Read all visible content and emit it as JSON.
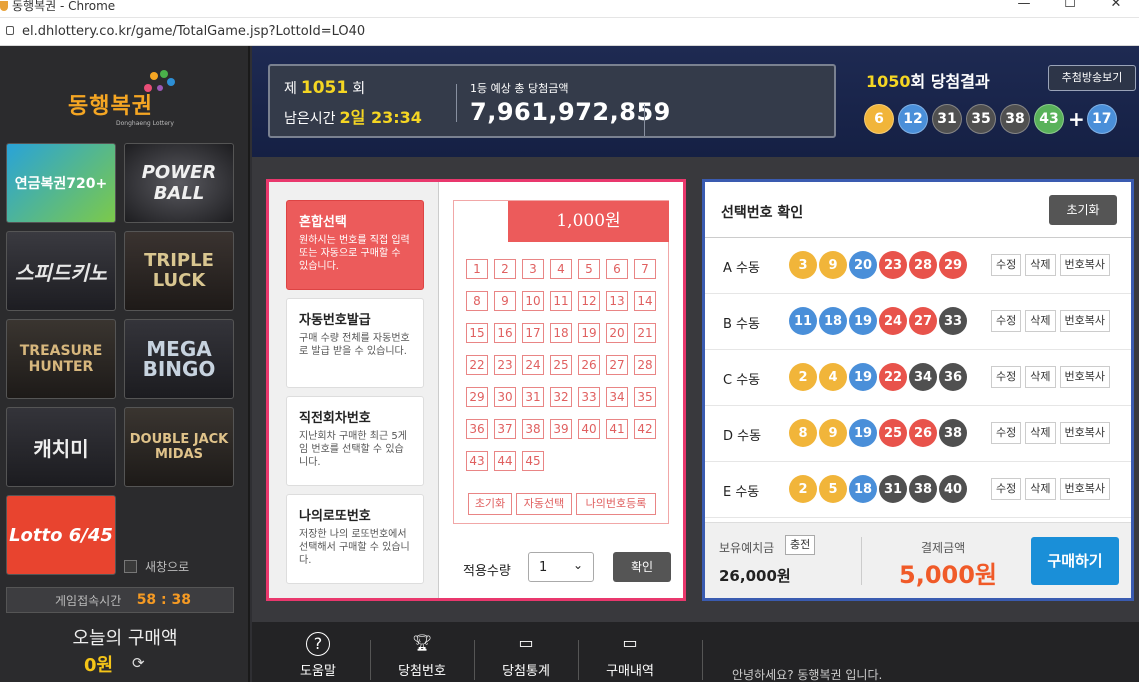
{
  "browser": {
    "title": "동행복권 - Chrome",
    "url": "el.dhlottery.co.kr/game/TotalGame.jsp?LottoId=LO40"
  },
  "sidebar": {
    "logo_text": "동행복권",
    "logo_sub": "Donghaeng Lottery",
    "games": [
      {
        "name": "연금복권720+"
      },
      {
        "name": "POWER BALL"
      },
      {
        "name": "스피드키노"
      },
      {
        "name": "TRIPLE LUCK"
      },
      {
        "name": "TREASURE HUNTER"
      },
      {
        "name": "MEGA BINGO"
      },
      {
        "name": "캐치미"
      },
      {
        "name": "DOUBLE JACK MIDAS"
      },
      {
        "name": "Lotto 6/45"
      }
    ],
    "new_window_label": "새창으로",
    "connect_label": "게임접속시간",
    "connect_time": "58 : 38",
    "today_label": "오늘의 구매액",
    "today_value": "0원"
  },
  "topbar": {
    "round_prefix": "제",
    "round_no": "1051",
    "round_suffix": "회",
    "remain_label": "남은시간",
    "remain_value": "2일 23:34",
    "prize_label": "1등 예상 총 당첨금액",
    "prize_value": "7,961,972,859",
    "result_round": "1050",
    "result_suffix": "회 당첨결과",
    "watch_button": "추첨방송보기",
    "win_numbers": [
      {
        "n": "6",
        "c": "y"
      },
      {
        "n": "12",
        "c": "b"
      },
      {
        "n": "31",
        "c": "g"
      },
      {
        "n": "35",
        "c": "g"
      },
      {
        "n": "38",
        "c": "g"
      },
      {
        "n": "43",
        "c": "gr"
      }
    ],
    "bonus": {
      "n": "17",
      "c": "b"
    }
  },
  "methods": [
    {
      "title": "혼합선택",
      "desc": "원하시는 번호를 직접 입력 또는 자동으로 구매할 수 있습니다.",
      "active": true
    },
    {
      "title": "자동번호발급",
      "desc": "구매 수량 전체를 자동번호로 발급 받을 수 있습니다.",
      "active": false
    },
    {
      "title": "직전회차번호",
      "desc": "지난회차 구매한 최근 5게임 번호를 선택할 수 있습니다.",
      "active": false
    },
    {
      "title": "나의로또번호",
      "desc": "저장한 나의 로또번호에서 선택해서 구매할 수 있습니다.",
      "active": false
    }
  ],
  "slip": {
    "price": "1,000원",
    "numbers": [
      "1",
      "2",
      "3",
      "4",
      "5",
      "6",
      "7",
      "8",
      "9",
      "10",
      "11",
      "12",
      "13",
      "14",
      "15",
      "16",
      "17",
      "18",
      "19",
      "20",
      "21",
      "22",
      "23",
      "24",
      "25",
      "26",
      "27",
      "28",
      "29",
      "30",
      "31",
      "32",
      "33",
      "34",
      "35",
      "36",
      "37",
      "38",
      "39",
      "40",
      "41",
      "42",
      "43",
      "44",
      "45"
    ],
    "reset": "초기화",
    "auto": "자동선택",
    "mynum": "나의번호등록"
  },
  "quantity": {
    "label": "적용수량",
    "value": "1",
    "confirm": "확인"
  },
  "selected": {
    "title": "선택번호 확인",
    "reset": "초기화",
    "rows": [
      {
        "label": "A 수동",
        "balls": [
          {
            "n": "3",
            "c": "y"
          },
          {
            "n": "9",
            "c": "y"
          },
          {
            "n": "20",
            "c": "b"
          },
          {
            "n": "23",
            "c": "r"
          },
          {
            "n": "28",
            "c": "r"
          },
          {
            "n": "29",
            "c": "r"
          }
        ]
      },
      {
        "label": "B 수동",
        "balls": [
          {
            "n": "11",
            "c": "b"
          },
          {
            "n": "18",
            "c": "b"
          },
          {
            "n": "19",
            "c": "b"
          },
          {
            "n": "24",
            "c": "r"
          },
          {
            "n": "27",
            "c": "r"
          },
          {
            "n": "33",
            "c": "g"
          }
        ]
      },
      {
        "label": "C 수동",
        "balls": [
          {
            "n": "2",
            "c": "y"
          },
          {
            "n": "4",
            "c": "y"
          },
          {
            "n": "19",
            "c": "b"
          },
          {
            "n": "22",
            "c": "r"
          },
          {
            "n": "34",
            "c": "g"
          },
          {
            "n": "36",
            "c": "g"
          }
        ]
      },
      {
        "label": "D 수동",
        "balls": [
          {
            "n": "8",
            "c": "y"
          },
          {
            "n": "9",
            "c": "y"
          },
          {
            "n": "19",
            "c": "b"
          },
          {
            "n": "25",
            "c": "r"
          },
          {
            "n": "26",
            "c": "r"
          },
          {
            "n": "38",
            "c": "g"
          }
        ]
      },
      {
        "label": "E 수동",
        "balls": [
          {
            "n": "2",
            "c": "y"
          },
          {
            "n": "5",
            "c": "y"
          },
          {
            "n": "18",
            "c": "b"
          },
          {
            "n": "31",
            "c": "g"
          },
          {
            "n": "38",
            "c": "g"
          },
          {
            "n": "40",
            "c": "g"
          }
        ]
      }
    ],
    "actions": [
      "수정",
      "삭제",
      "번호복사"
    ],
    "balance_label": "보유예치금",
    "charge": "충전",
    "balance": "26,000원",
    "pay_label": "결제금액",
    "pay": "5,000원",
    "buy": "구매하기"
  },
  "bottom_nav": [
    {
      "label": "도움말",
      "icon": "help-icon"
    },
    {
      "label": "당첨번호",
      "icon": "trophy-icon"
    },
    {
      "label": "당첨통계",
      "icon": "stats-icon"
    },
    {
      "label": "구매내역",
      "icon": "card-icon"
    }
  ],
  "greeting": "안녕하세요? 동행복권 입니다."
}
